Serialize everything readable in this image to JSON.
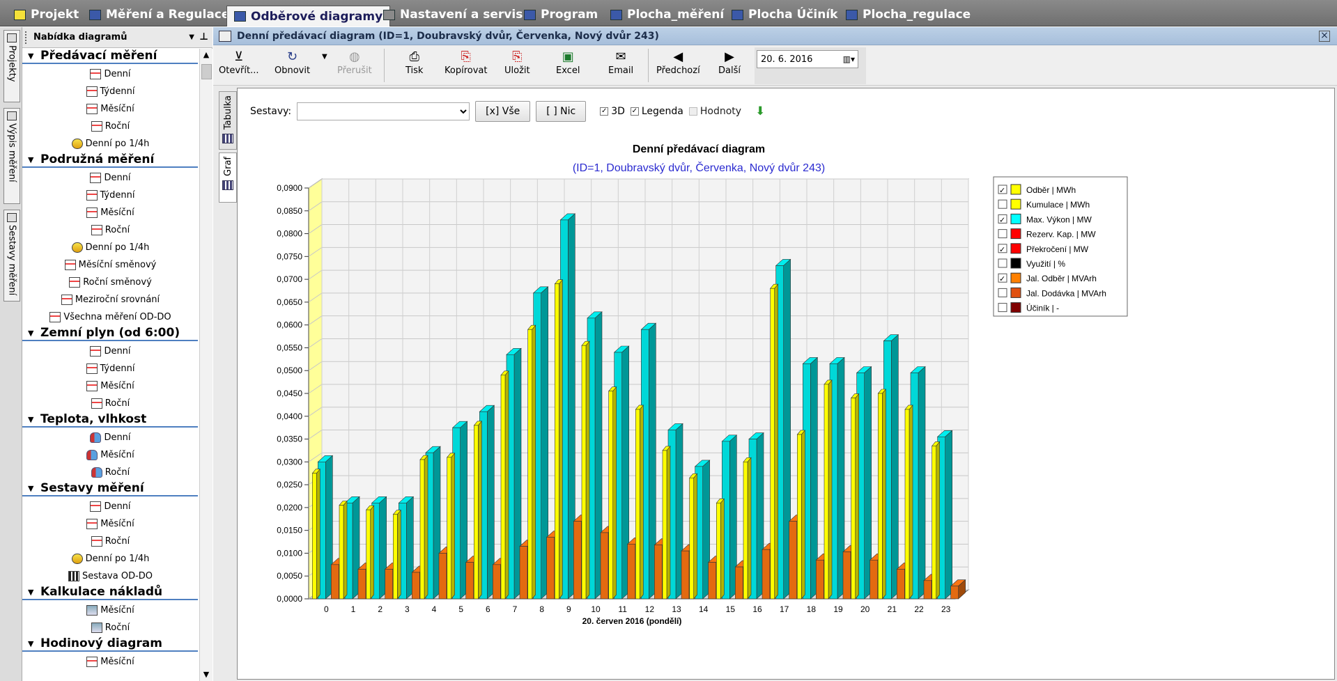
{
  "top_tabs": [
    {
      "label": "Projekt",
      "icon": "folder-icon",
      "color": "#f5e13a"
    },
    {
      "label": "Měření a Regulace",
      "icon": "meter-icon",
      "color": "#3b59a8"
    },
    {
      "label": "Odběrové diagramy",
      "icon": "table-icon",
      "color": "#3b59a8",
      "active": true
    },
    {
      "label": "Nastavení a servis",
      "icon": "tools-icon",
      "color": "#8a8a8a"
    },
    {
      "label": "Program",
      "icon": "bar-chart-icon",
      "color": "#3b59a8"
    },
    {
      "label": "Plocha_měření",
      "icon": "screen-icon",
      "color": "#3b59a8"
    },
    {
      "label": "Plocha Účiník",
      "icon": "screen-icon",
      "color": "#3b59a8"
    },
    {
      "label": "Plocha_regulace",
      "icon": "screen-icon",
      "color": "#3b59a8"
    }
  ],
  "left_strip": {
    "tabs": [
      "Projekty",
      "Výpis měření",
      "Sestavy měření"
    ]
  },
  "panel": {
    "title": "Nabídka diagramů",
    "groups": [
      {
        "label": "Předávací měření",
        "items": [
          "Denní",
          "Týdenní",
          "Měsíční",
          "Roční",
          "Denní po 1/4h"
        ]
      },
      {
        "label": "Podružná měření",
        "items": [
          "Denní",
          "Týdenní",
          "Měsíční",
          "Roční",
          "Denní po 1/4h",
          "Měsíční směnový",
          "Roční směnový",
          "Meziroční srovnání",
          "Všechna měření OD-DO"
        ]
      },
      {
        "label": "Zemní plyn (od 6:00)",
        "items": [
          "Denní",
          "Týdenní",
          "Měsíční",
          "Roční"
        ]
      },
      {
        "label": "Teplota, vlhkost",
        "items": [
          "Denní",
          "Měsíční",
          "Roční"
        ]
      },
      {
        "label": "Sestavy měření",
        "items": [
          "Denní",
          "Měsíční",
          "Roční",
          "Denní po 1/4h",
          "Sestava OD-DO"
        ]
      },
      {
        "label": "Kalkulace nákladů",
        "items": [
          "Měsíční",
          "Roční"
        ]
      },
      {
        "label": "Hodinový diagram",
        "items": [
          "Měsíční"
        ]
      }
    ]
  },
  "window": {
    "title": "Denní předávací diagram (ID=1, Doubravský dvůr, Červenka, Nový dvůr 243)"
  },
  "toolbar": {
    "open": "Otevřít...",
    "refresh": "Obnovit",
    "stop": "Přerušit",
    "print": "Tisk",
    "copy": "Kopírovat",
    "save": "Uložit",
    "excel": "Excel",
    "email": "Email",
    "prev": "Předchozí",
    "next": "Další",
    "date": "20.  6. 2016"
  },
  "view_tabs": {
    "table": "Tabulka",
    "graph": "Graf"
  },
  "controls": {
    "sestavy_label": "Sestavy:",
    "all_btn": "[x] Vše",
    "none_btn": "[ ] Nic",
    "chk_3d": "3D",
    "chk_legend": "Legenda",
    "chk_values": "Hodnoty"
  },
  "chart_data": {
    "type": "bar",
    "title": "Denní předávací diagram",
    "subtitle": "(ID=1, Doubravský dvůr, Červenka, Nový dvůr 243)",
    "xlabel": "20. červen 2016 (pondělí)",
    "ylim": [
      0,
      0.09
    ],
    "yticks": [
      "0,0000",
      "0,0050",
      "0,0100",
      "0,0150",
      "0,0200",
      "0,0250",
      "0,0300",
      "0,0350",
      "0,0400",
      "0,0450",
      "0,0500",
      "0,0550",
      "0,0600",
      "0,0650",
      "0,0700",
      "0,0750",
      "0,0800",
      "0,0850",
      "0,0900"
    ],
    "categories": [
      "0",
      "1",
      "2",
      "3",
      "4",
      "5",
      "6",
      "7",
      "8",
      "9",
      "10",
      "11",
      "12",
      "13",
      "14",
      "15",
      "16",
      "17",
      "18",
      "19",
      "20",
      "21",
      "22",
      "23"
    ],
    "series": [
      {
        "name": "Odběr | MWh",
        "color": "#ffff00",
        "values": [
          0.0275,
          0.0205,
          0.0195,
          0.0185,
          0.0305,
          0.031,
          0.038,
          0.049,
          0.059,
          0.069,
          0.0555,
          0.0455,
          0.0415,
          0.0325,
          0.0265,
          0.021,
          0.03,
          0.068,
          0.036,
          0.047,
          0.044,
          0.045,
          0.0415,
          0.0335
        ]
      },
      {
        "name": "Max. Výkon | MW",
        "color": "#00d8d8",
        "values": [
          0.03,
          0.021,
          0.021,
          0.021,
          0.032,
          0.0375,
          0.041,
          0.0535,
          0.067,
          0.083,
          0.0615,
          0.054,
          0.059,
          0.037,
          0.029,
          0.0345,
          0.035,
          0.073,
          0.0515,
          0.0515,
          0.0495,
          0.0565,
          0.0495,
          0.0355
        ]
      },
      {
        "name": "Jal. Odběr | MVArh",
        "color": "#e36a10",
        "values": [
          0.0075,
          0.0065,
          0.0065,
          0.0058,
          0.01,
          0.008,
          0.0075,
          0.0115,
          0.0135,
          0.017,
          0.0145,
          0.012,
          0.0118,
          0.0105,
          0.008,
          0.007,
          0.0108,
          0.017,
          0.0085,
          0.0103,
          0.0085,
          0.0065,
          0.004,
          0.0028
        ]
      }
    ],
    "legend": [
      {
        "label": "Odběr | MWh",
        "color": "#ffff00",
        "checked": true
      },
      {
        "label": "Kumulace | MWh",
        "color": "#ffff00",
        "checked": false
      },
      {
        "label": "Max. Výkon | MW",
        "color": "#00ffff",
        "checked": true
      },
      {
        "label": "Rezerv. Kap. | MW",
        "color": "#ff0000",
        "checked": false
      },
      {
        "label": "Překročení | MW",
        "color": "#ff0000",
        "checked": true
      },
      {
        "label": "Využití | %",
        "color": "#000000",
        "checked": false
      },
      {
        "label": "Jal. Odběr | MVArh",
        "color": "#ff8000",
        "checked": true
      },
      {
        "label": "Jal. Dodávka | MVArh",
        "color": "#e05010",
        "checked": false
      },
      {
        "label": "Účiník | -",
        "color": "#800000",
        "checked": false
      }
    ],
    "legend_position": "right",
    "grid": true
  }
}
